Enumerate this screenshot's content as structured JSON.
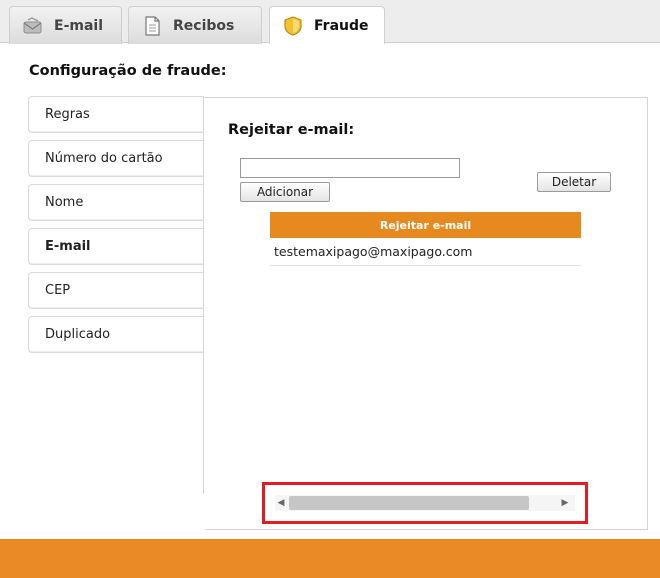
{
  "tabs": [
    {
      "label": "E-mail",
      "icon": "envelope-icon"
    },
    {
      "label": "Recibos",
      "icon": "document-icon"
    },
    {
      "label": "Fraude",
      "icon": "shield-icon",
      "active": true
    }
  ],
  "section_title": "Configuração de fraude:",
  "sidebar": {
    "items": [
      {
        "label": "Regras"
      },
      {
        "label": "Número do cartão"
      },
      {
        "label": "Nome"
      },
      {
        "label": "E-mail",
        "active": true
      },
      {
        "label": "CEP"
      },
      {
        "label": "Duplicado"
      }
    ]
  },
  "panel": {
    "title": "Rejeitar e-mail:",
    "input_value": "",
    "add_label": "Adicionar",
    "delete_label": "Deletar",
    "list_header": "Rejeitar e-mail",
    "list_items": [
      "testemaxipago@maxipago.com"
    ]
  },
  "colors": {
    "accent": "#e68a1f",
    "highlight": "#e31b23"
  }
}
